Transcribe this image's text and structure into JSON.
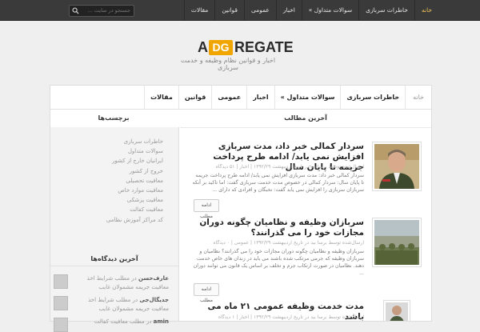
{
  "topbar": {
    "nav": [
      "خانه",
      "خاطرات سربازی",
      "سوالات متداول »",
      "اخبار",
      "عمومی",
      "قوانین",
      "مقالات"
    ],
    "search_placeholder": "جستجو در سایت ..."
  },
  "logo": {
    "a": "A",
    "dg": "DG",
    "rest": "REGATE"
  },
  "tagline": "اخبار و قوانین نظام وظیفه و خدمت سربازی",
  "mainnav": [
    "خانه",
    "خاطرات سربازی",
    "سوالات متداول »",
    "اخبار",
    "عمومی",
    "قوانین",
    "مقالات"
  ],
  "main_heading": "آخرین مطالب",
  "sidebar": {
    "heading": "برچسب‌ها",
    "tags": [
      "خاطرات سربازی",
      "سوالات متداول",
      "ایرانیان خارج از کشور",
      "خروج از کشور",
      "معافیت تحصیلی",
      "معافیت موارد خاص",
      "معافیت پزشکی",
      "معافیت کفالت",
      "کد مراکز آموزش نظامی"
    ],
    "comments_heading": "آخرین دیدگاه‌ها",
    "comments": [
      {
        "author": "عارف‌حسن",
        "text": "در مطلب شرایط اخذ معافیت جریمه مشمولان غایب"
      },
      {
        "author": "جدیگال‌جی",
        "text": "در مطلب شرایط اخذ معافیت جریمه مشمولان غایب"
      },
      {
        "author": "amin",
        "text": "در مطلب معافیت کفالت"
      }
    ]
  },
  "posts": [
    {
      "title": "سردار کمالی خبر داد، مدت سربازی افزایش نمی یابد/ ادامه طرح پرداخت جریمه تا پایان سال",
      "meta": "ارسال‌شده توسط برسا بید در تاریخ اردیبهشت ۱۳۹۲/۲۹ | اخبار | ۵۱ دیدگاه",
      "excerpt": "سردار کمالی خبر داد: مدت سربازی افزایش نمی یابد/ ادامه طرح پرداخت جریمه تا پایان سال: سردار کمالی در خصوص مدت خدمت سربازی گفت: اما تاکید بر آنکه سربازان سربازی را افزایش نمی یابد گفت: نخبگان و افرادی که دارای ..."
    },
    {
      "title": "سربازان وظیفه و نظامیان چگونه دوران مجازات خود را می گذرانند؟",
      "meta": "ارسال‌شده توسط برسا بید در تاریخ اردیبهشت ۱۳۹۲/۲۹ | عمومی | ۰ دیدگاه",
      "excerpt": "سربازان وظیفه و نظامیان چگونه دوران مجازات خود را می گذرانند؟ نظامیان و سربازان وظیفه که جرمی مرتکب شده باشند می باید در زندان های خاص خدمت دهند. نظامیان در صورت ارتکاب جرم و تخلف بر اساس یک قانون می توانند دوران ..."
    },
    {
      "title": "مدت خدمت وظیفه عمومی ۲۱ ماه می باشد",
      "meta": "ارسال‌شده توسط برسا بید در تاریخ اردیبهشت ۱۳۹۲/۲۹ | اخبار | ۱ دیدگاه",
      "excerpt": ""
    }
  ],
  "read_more": "ادامه مطلب"
}
